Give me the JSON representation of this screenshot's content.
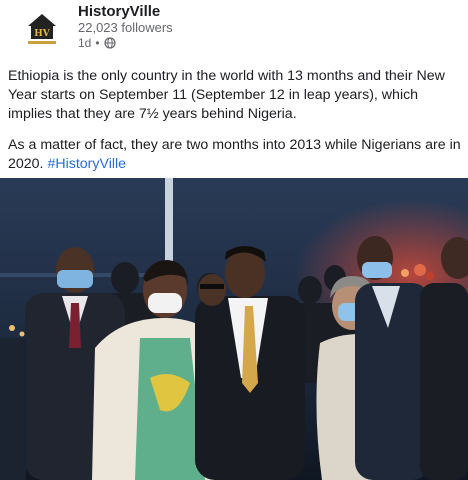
{
  "page": {
    "name": "HistoryVille",
    "followers": "22,023 followers",
    "time": "1d",
    "separator": "•",
    "privacy_icon": "globe-icon",
    "logo_text": "HV"
  },
  "post": {
    "paragraph1": "Ethiopia is the only country in the world with 13 months and their New Year starts on September 11 (September 12 in leap years), which implies that they are 7½ years behind Nigeria.",
    "paragraph2_text": "As a matter of fact, they are two months into 2013 while Nigerians are in 2020. ",
    "hashtag": "#HistoryVille"
  },
  "colors": {
    "link": "#216fdb",
    "secondary_text": "#65676b"
  }
}
